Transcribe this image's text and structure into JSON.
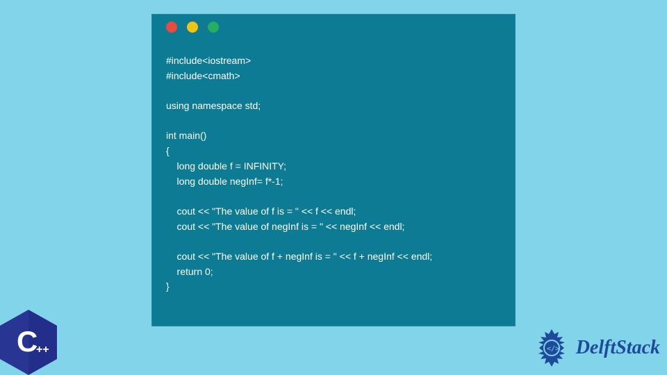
{
  "code_lines": [
    "#include<iostream>",
    "#include<cmath>",
    "",
    "using namespace std;",
    "",
    "int main()",
    "{",
    "    long double f = INFINITY;",
    "    long double negInf= f*-1;",
    "",
    "    cout << \"The value of f is = \" << f << endl;",
    "    cout << \"The value of negInf is = \" << negInf << endl;",
    "",
    "    cout << \"The value of f + negInf is = \" << f + negInf << endl;",
    "    return 0;",
    "}"
  ],
  "cpp_badge": {
    "letter": "C",
    "plus": "++"
  },
  "brand": {
    "name": "DelftStack"
  },
  "colors": {
    "background": "#81d4ea",
    "window": "#0c7b93",
    "dot_red": "#e74c3c",
    "dot_yellow": "#f1c40f",
    "dot_green": "#27ae60",
    "cpp_blue": "#283593",
    "brand_blue": "#1d4a9a"
  }
}
